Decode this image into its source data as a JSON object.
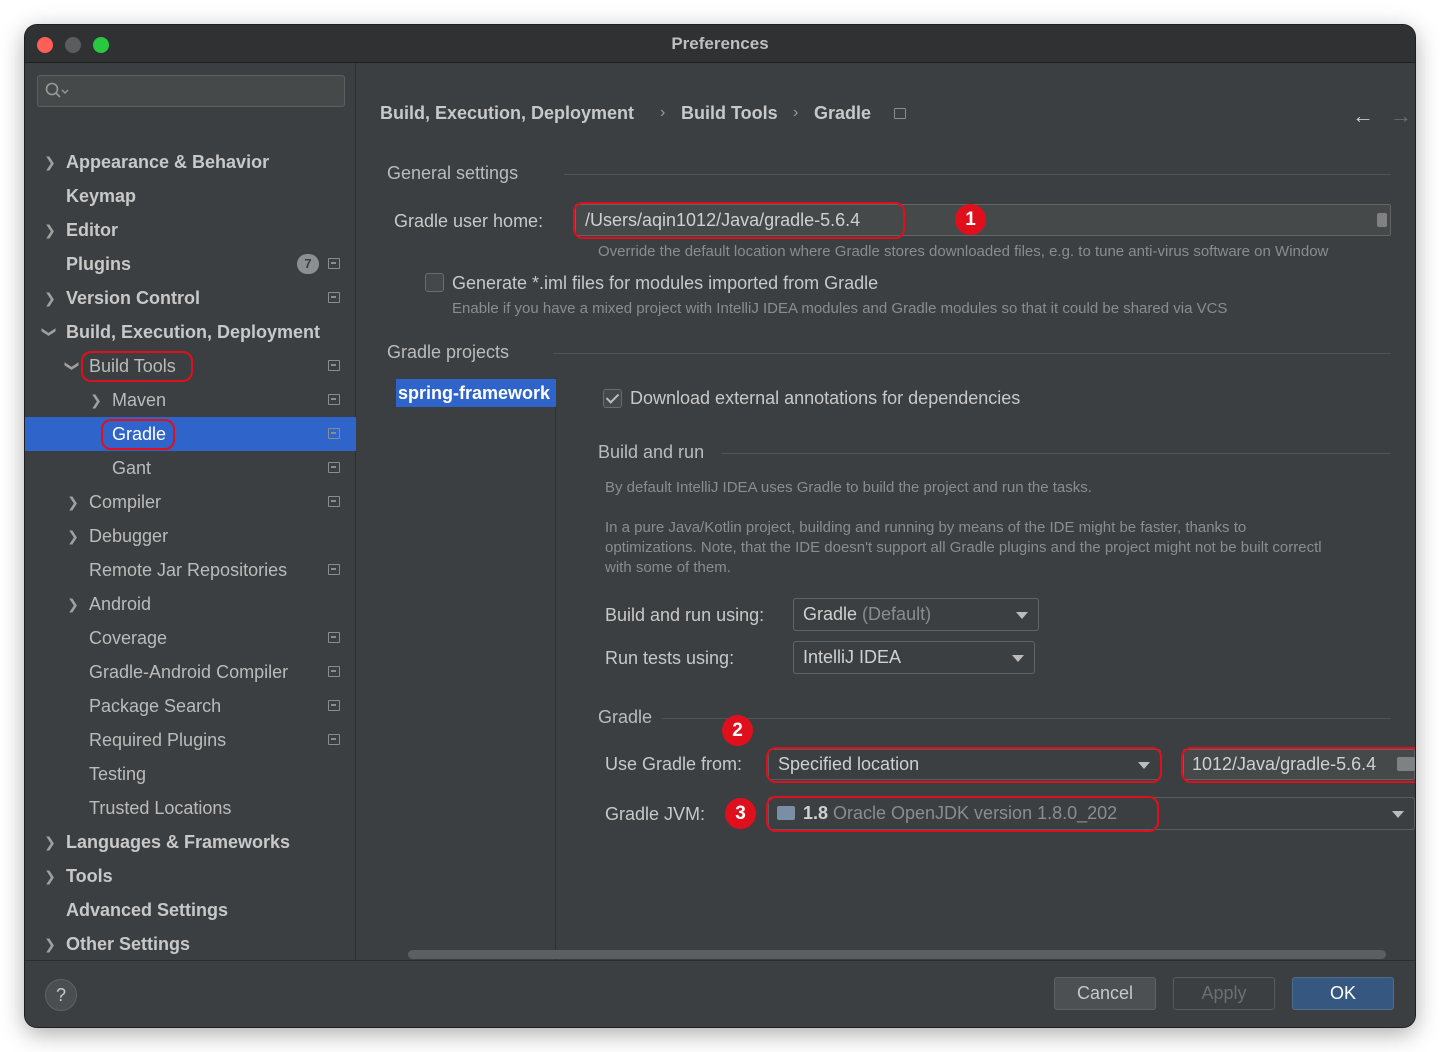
{
  "window": {
    "title": "Preferences"
  },
  "search": {
    "placeholder": ""
  },
  "sidebar": {
    "items": [
      {
        "label": "Appearance & Behavior"
      },
      {
        "label": "Keymap"
      },
      {
        "label": "Editor"
      },
      {
        "label": "Plugins",
        "badge": "7"
      },
      {
        "label": "Version Control"
      },
      {
        "label": "Build, Execution, Deployment"
      },
      {
        "label": "Build Tools"
      },
      {
        "label": "Maven"
      },
      {
        "label": "Gradle"
      },
      {
        "label": "Gant"
      },
      {
        "label": "Compiler"
      },
      {
        "label": "Debugger"
      },
      {
        "label": "Remote Jar Repositories"
      },
      {
        "label": "Android"
      },
      {
        "label": "Coverage"
      },
      {
        "label": "Gradle-Android Compiler"
      },
      {
        "label": "Package Search"
      },
      {
        "label": "Required Plugins"
      },
      {
        "label": "Testing"
      },
      {
        "label": "Trusted Locations"
      },
      {
        "label": "Languages & Frameworks"
      },
      {
        "label": "Tools"
      },
      {
        "label": "Advanced Settings"
      },
      {
        "label": "Other Settings"
      }
    ]
  },
  "breadcrumb": {
    "items": [
      "Build, Execution, Deployment",
      "Build Tools",
      "Gradle"
    ],
    "separator": "›",
    "back": "←",
    "forward": "→"
  },
  "general": {
    "title": "General settings",
    "user_home_label": "Gradle user home:",
    "user_home_value": "/Users/aqin1012/Java/gradle-5.6.4",
    "user_home_hint": "Override the default location where Gradle stores downloaded files, e.g. to tune anti-virus software on Window",
    "iml_label": "Generate *.iml files for modules imported from Gradle",
    "iml_hint": "Enable if you have a mixed project with IntelliJ IDEA modules and Gradle modules so that it could be shared via VCS"
  },
  "projects": {
    "title": "Gradle projects",
    "list": [
      "spring-framework"
    ],
    "download_annotations": "Download external annotations for dependencies"
  },
  "build_run": {
    "title": "Build and run",
    "desc1": "By default IntelliJ IDEA uses Gradle to build the project and run the tasks.",
    "desc2a": "In a pure Java/Kotlin project, building and running by means of the IDE might be faster, thanks to",
    "desc2b": "optimizations. Note, that the IDE doesn't support all Gradle plugins and the project might not be built correctl",
    "desc2c": "with some of them.",
    "using_label": "Build and run using:",
    "using_value": "Gradle",
    "using_suffix": "(Default)",
    "tests_label": "Run tests using:",
    "tests_value": "IntelliJ IDEA"
  },
  "gradle": {
    "title": "Gradle",
    "use_from_label": "Use Gradle from:",
    "use_from_value": "Specified location",
    "location_value": "1012/Java/gradle-5.6.4",
    "jvm_label": "Gradle JVM:",
    "jvm_version": "1.8",
    "jvm_desc": "Oracle OpenJDK version 1.8.0_202"
  },
  "markers": [
    "1",
    "2",
    "3"
  ],
  "footer": {
    "help": "?",
    "cancel": "Cancel",
    "apply": "Apply",
    "ok": "OK"
  },
  "colors": {
    "accent": "#2f65ca",
    "highlight": "#e00f1c",
    "background": "#3c3f41",
    "primary_button": "#365880"
  }
}
